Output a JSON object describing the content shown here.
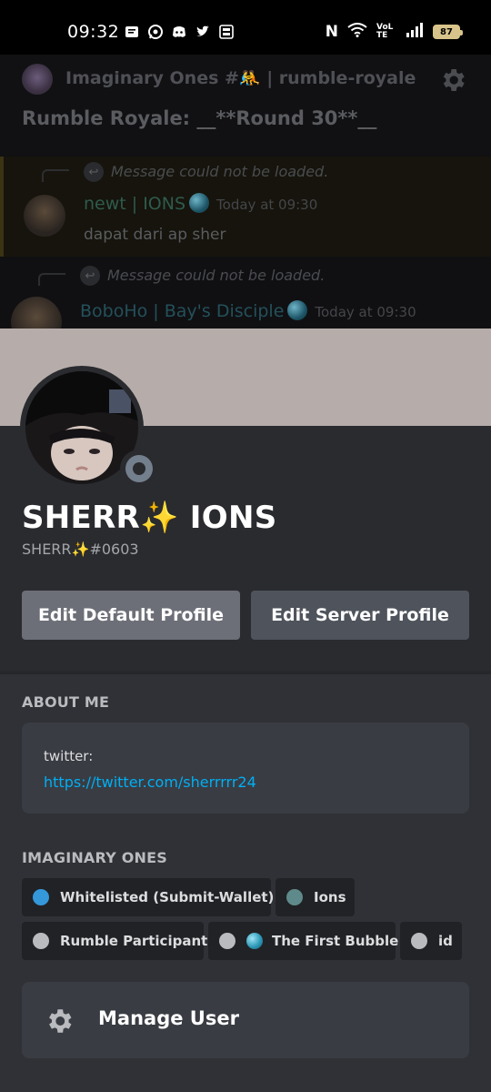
{
  "status_bar": {
    "time": "09:32",
    "network": "VoLTE",
    "battery": "87",
    "notification_icons": [
      "messages-icon",
      "whatsapp-icon",
      "discord-icon",
      "twitter-icon",
      "app-icon"
    ]
  },
  "chat_background": {
    "server_channel": "Imaginary Ones #🤼 | rumble-royale",
    "topic": "Rumble Royale: __**Round 30**__",
    "messages": [
      {
        "reply_note": "Message could not be loaded.",
        "author": "newt | IONS",
        "time": "Today at 09:30",
        "text": "dapat dari ap sher"
      },
      {
        "reply_note": "Message could not be loaded.",
        "author": "BoboHo | Bay's Disciple",
        "time": "Today at 09:30",
        "text": ""
      }
    ]
  },
  "profile": {
    "display_name": "SHERR✨ IONS",
    "tag": "SHERR✨#0603",
    "banner_color": "#b6adaa",
    "status_color": "#747f8d",
    "buttons": {
      "edit_default": "Edit Default Profile",
      "edit_server": "Edit Server Profile"
    },
    "about_me": {
      "heading": "ABOUT ME",
      "label": "twitter:",
      "link": "https://twitter.com/sherrrrr24"
    },
    "roles_section": {
      "heading": "IMAGINARY ONES",
      "roles": [
        {
          "name": "Whitelisted (Submit-Wallet)",
          "color": "#3498db"
        },
        {
          "name": "Ions",
          "color": "#5f8a8b"
        },
        {
          "name": "Rumble Participant",
          "color": "#b9bbbe"
        },
        {
          "name": "The First Bubble",
          "color": "#b9bbbe"
        },
        {
          "name": "id",
          "color": "#b9bbbe"
        }
      ]
    },
    "manage_user": {
      "label": "Manage User",
      "icon": "gear-icon"
    }
  },
  "colors": {
    "link": "#00aff4",
    "sheet_bg": "#2a2b2f",
    "content_bg": "#2f3136",
    "card_bg": "#393c43"
  }
}
